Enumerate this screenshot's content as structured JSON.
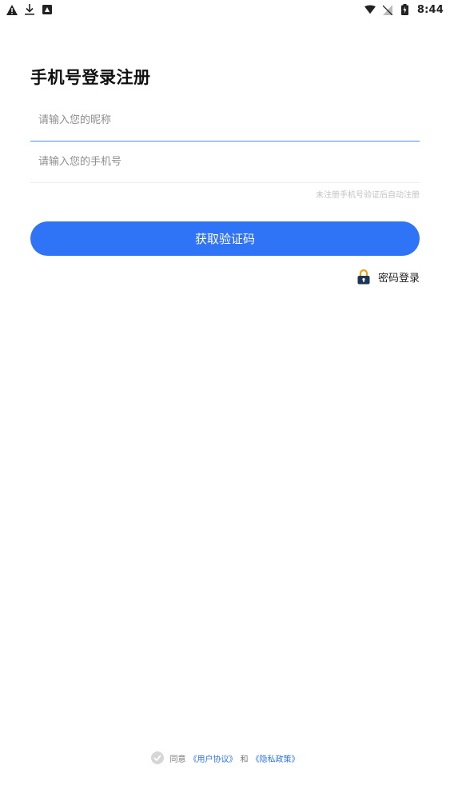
{
  "status_bar": {
    "time": "8:44",
    "left_icons": [
      "warning-icon",
      "download-icon",
      "app-notification-icon"
    ],
    "right_icons": [
      "wifi-icon",
      "no-sim-icon",
      "battery-charging-icon"
    ]
  },
  "title": "手机号登录注册",
  "form": {
    "nickname_placeholder": "请输入您的昵称",
    "nickname_value": "",
    "phone_placeholder": "请输入您的手机号",
    "phone_value": "",
    "hint": "未注册手机号验证后自动注册"
  },
  "primary_button": {
    "label": "获取验证码",
    "color": "#2f73f7"
  },
  "password_login": {
    "label": "密码登录",
    "icon": "lock-icon"
  },
  "agreement": {
    "prefix": "同意",
    "user_agreement": "《用户协议》",
    "connector": "和",
    "privacy_policy": "《隐私政策》",
    "checked": false
  },
  "colors": {
    "accent": "#2f73f7",
    "focus_underline": "#4a8cf0"
  }
}
